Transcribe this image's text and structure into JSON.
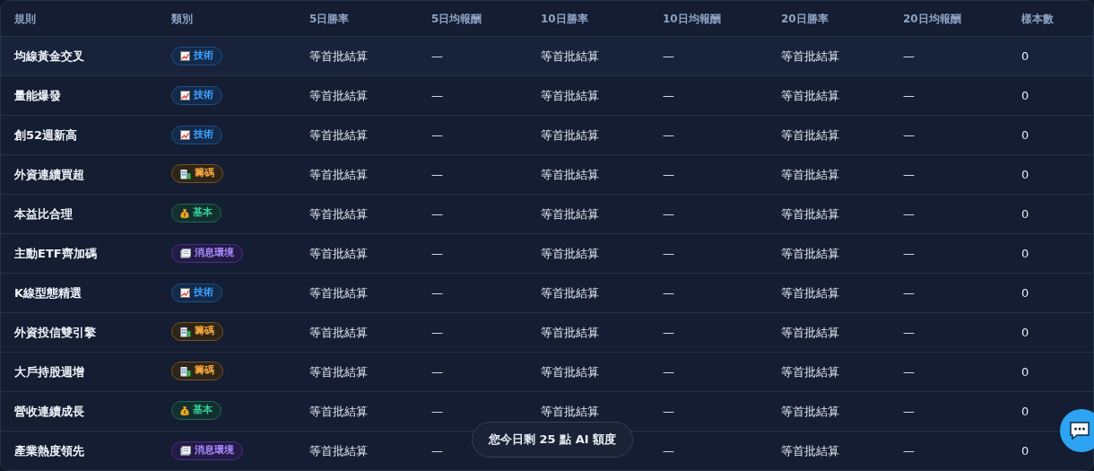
{
  "table": {
    "columns": [
      "規則",
      "類別",
      "5日勝率",
      "5日均報酬",
      "10日勝率",
      "10日均報酬",
      "20日勝率",
      "20日均報酬",
      "樣本數"
    ],
    "rows": [
      {
        "kind": "technical",
        "cells": [
          "均線黃金交叉",
          "技術",
          "等首批結算",
          "—",
          "等首批結算",
          "—",
          "等首批結算",
          "—",
          "0"
        ]
      },
      {
        "kind": "technical",
        "cells": [
          "量能爆發",
          "技術",
          "等首批結算",
          "—",
          "等首批結算",
          "—",
          "等首批結算",
          "—",
          "0"
        ]
      },
      {
        "kind": "technical",
        "cells": [
          "創52週新高",
          "技術",
          "等首批結算",
          "—",
          "等首批結算",
          "—",
          "等首批結算",
          "—",
          "0"
        ]
      },
      {
        "kind": "chips",
        "cells": [
          "外資連續買超",
          "籌碼",
          "等首批結算",
          "—",
          "等首批結算",
          "—",
          "等首批結算",
          "—",
          "0"
        ]
      },
      {
        "kind": "fundamental",
        "cells": [
          "本益比合理",
          "基本",
          "等首批結算",
          "—",
          "等首批結算",
          "—",
          "等首批結算",
          "—",
          "0"
        ]
      },
      {
        "kind": "news",
        "cells": [
          "主動ETF齊加碼",
          "消息環境",
          "等首批結算",
          "—",
          "等首批結算",
          "—",
          "等首批結算",
          "—",
          "0"
        ]
      },
      {
        "kind": "technical",
        "cells": [
          "K線型態精選",
          "技術",
          "等首批結算",
          "—",
          "等首批結算",
          "—",
          "等首批結算",
          "—",
          "0"
        ]
      },
      {
        "kind": "chips",
        "cells": [
          "外資投信雙引擎",
          "籌碼",
          "等首批結算",
          "—",
          "等首批結算",
          "—",
          "等首批結算",
          "—",
          "0"
        ]
      },
      {
        "kind": "chips",
        "cells": [
          "大戶持股週增",
          "籌碼",
          "等首批結算",
          "—",
          "等首批結算",
          "—",
          "等首批結算",
          "—",
          "0"
        ]
      },
      {
        "kind": "fundamental",
        "cells": [
          "營收連續成長",
          "基本",
          "等首批結算",
          "—",
          "等首批結算",
          "—",
          "等首批結算",
          "—",
          "0"
        ]
      },
      {
        "kind": "news",
        "cells": [
          "產業熱度領先",
          "消息環境",
          "等首批結算",
          "—",
          null,
          "—",
          "等首批結算",
          "—",
          "0"
        ]
      }
    ]
  },
  "toast": "您今日剩 25 點 AI 額度"
}
